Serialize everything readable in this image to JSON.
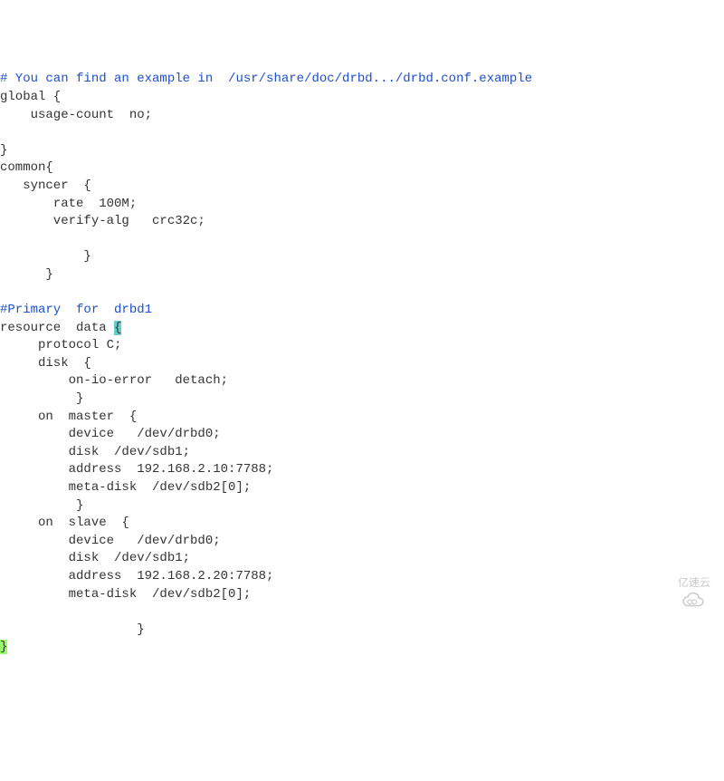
{
  "lines": [
    {
      "type": "comment",
      "text": "# You can find an example in  /usr/share/doc/drbd.../drbd.conf.example"
    },
    {
      "type": "normal",
      "text": "global {"
    },
    {
      "type": "normal",
      "text": "    usage-count  no;"
    },
    {
      "type": "normal",
      "text": ""
    },
    {
      "type": "normal",
      "text": "}"
    },
    {
      "type": "normal",
      "text": "common{"
    },
    {
      "type": "normal",
      "text": "   syncer  {"
    },
    {
      "type": "normal",
      "text": "       rate  100M;"
    },
    {
      "type": "normal",
      "text": "       verify-alg   crc32c;"
    },
    {
      "type": "normal",
      "text": ""
    },
    {
      "type": "normal",
      "text": "           }"
    },
    {
      "type": "normal",
      "text": "      }"
    },
    {
      "type": "normal",
      "text": ""
    },
    {
      "type": "comment",
      "text": "#Primary  for  drbd1"
    },
    {
      "type": "cursor",
      "prefix": "resource  data ",
      "highlight": "{"
    },
    {
      "type": "normal",
      "text": "     protocol C;"
    },
    {
      "type": "normal",
      "text": "     disk  {"
    },
    {
      "type": "normal",
      "text": "         on-io-error   detach;"
    },
    {
      "type": "normal",
      "text": "          }"
    },
    {
      "type": "normal",
      "text": "     on  master  {"
    },
    {
      "type": "normal",
      "text": "         device   /dev/drbd0;"
    },
    {
      "type": "normal",
      "text": "         disk  /dev/sdb1;"
    },
    {
      "type": "normal",
      "text": "         address  192.168.2.10:7788;"
    },
    {
      "type": "normal",
      "text": "         meta-disk  /dev/sdb2[0];"
    },
    {
      "type": "normal",
      "text": "          }"
    },
    {
      "type": "normal",
      "text": "     on  slave  {"
    },
    {
      "type": "normal",
      "text": "         device   /dev/drbd0;"
    },
    {
      "type": "normal",
      "text": "         disk  /dev/sdb1;"
    },
    {
      "type": "normal",
      "text": "         address  192.168.2.20:7788;"
    },
    {
      "type": "normal",
      "text": "         meta-disk  /dev/sdb2[0];"
    },
    {
      "type": "normal",
      "text": ""
    },
    {
      "type": "normal",
      "text": "                  }"
    },
    {
      "type": "end",
      "highlight": "}"
    }
  ],
  "watermark": {
    "text": "亿速云"
  }
}
